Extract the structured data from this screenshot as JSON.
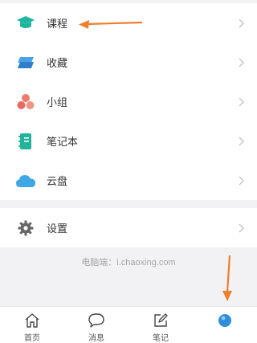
{
  "menu": {
    "items": [
      {
        "label": "课程",
        "icon": "graduation-cap-icon",
        "color": "#1fb6a0"
      },
      {
        "label": "收藏",
        "icon": "layers-icon",
        "color": "#2e8fd8"
      },
      {
        "label": "小组",
        "icon": "circles-icon",
        "color": "#e9695f"
      },
      {
        "label": "笔记本",
        "icon": "notebook-icon",
        "color": "#22b39a"
      },
      {
        "label": "云盘",
        "icon": "cloud-icon",
        "color": "#3ea7e6"
      }
    ],
    "settings": {
      "label": "设置",
      "icon": "gear-icon",
      "color": "#666666"
    }
  },
  "footer": {
    "note": "电脑端：i.chaoxing.com"
  },
  "tabbar": {
    "tabs": [
      {
        "label": "首页",
        "icon": "home-icon"
      },
      {
        "label": "消息",
        "icon": "chat-icon"
      },
      {
        "label": "笔记",
        "icon": "edit-icon"
      },
      {
        "label": "",
        "icon": "profile-icon"
      }
    ]
  },
  "annotations": {
    "arrow_color": "#f07f2c"
  }
}
